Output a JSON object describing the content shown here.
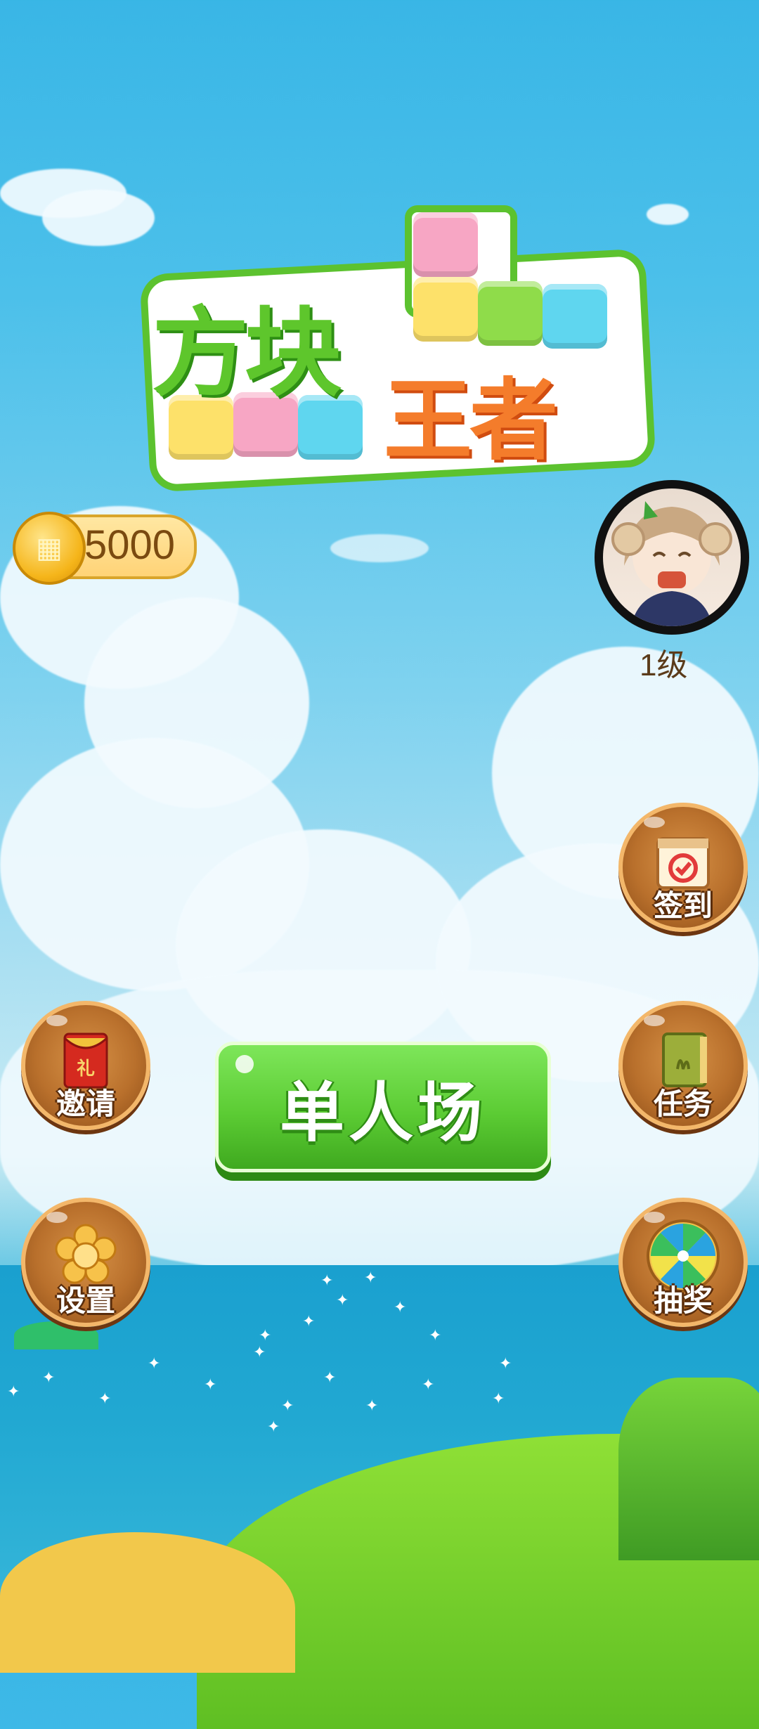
{
  "game": {
    "logo": {
      "line1": "方块",
      "line2": "王者"
    },
    "coins": {
      "value": "5000"
    },
    "player": {
      "level": "1级"
    },
    "buttons": {
      "checkin": "签到",
      "invite": "邀请",
      "tasks": "任务",
      "settings": "设置",
      "lottery": "抽奖",
      "single_player": "单人场"
    },
    "icons": {
      "coin": "coin-icon",
      "checkin": "calendar-check-icon",
      "invite": "red-envelope-icon",
      "tasks": "book-icon",
      "settings": "flower-gear-icon",
      "lottery": "wheel-icon"
    },
    "colors": {
      "primary_green": "#5ccc34",
      "button_brown": "#b9702c",
      "coin_gold": "#f5b51a"
    }
  }
}
